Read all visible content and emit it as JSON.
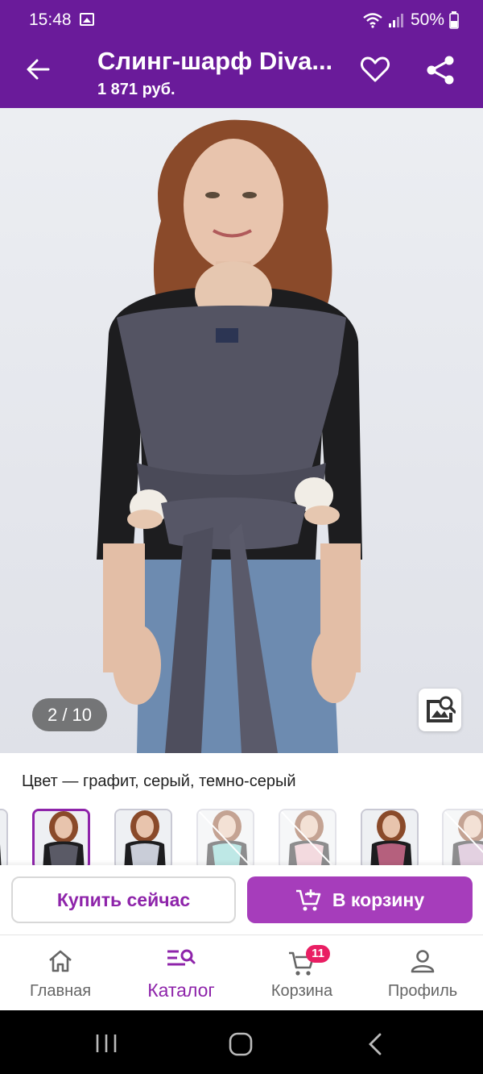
{
  "status_bar": {
    "time": "15:48",
    "battery": "50%"
  },
  "header": {
    "title": "Слинг-шарф Diva...",
    "price": "1 871 руб.",
    "back_icon": "arrow-left-icon",
    "favorite_icon": "heart-outline-icon",
    "share_icon": "share-icon"
  },
  "gallery": {
    "counter": "2 / 10",
    "image_search_icon": "image-search-icon"
  },
  "color": {
    "label": "Цвет",
    "separator": " — ",
    "value": "графит, серый, темно-серый",
    "thumbnails": [
      {
        "color": "#8a8a95",
        "state": "partial"
      },
      {
        "color": "#5a5a66",
        "state": "selected"
      },
      {
        "color": "#c9cdd8",
        "state": "normal"
      },
      {
        "color": "#7fd3cf",
        "state": "unavailable"
      },
      {
        "color": "#e8b7c0",
        "state": "unavailable"
      },
      {
        "color": "#b5607d",
        "state": "normal"
      },
      {
        "color": "#c9a4c4",
        "state": "unavailable"
      }
    ]
  },
  "actions": {
    "buy_now": "Купить сейчас",
    "add_to_cart": "В корзину"
  },
  "bottom_nav": {
    "items": [
      {
        "label": "Главная",
        "icon": "home-icon",
        "active": false
      },
      {
        "label": "Каталог",
        "icon": "catalog-search-icon",
        "active": true
      },
      {
        "label": "Корзина",
        "icon": "cart-icon",
        "active": false,
        "badge": "11"
      },
      {
        "label": "Профиль",
        "icon": "profile-icon",
        "active": false
      }
    ]
  },
  "colors": {
    "primary": "#6a1b9a",
    "accent": "#8e24aa",
    "cart_button": "#a63dbb",
    "badge": "#e91e63"
  }
}
